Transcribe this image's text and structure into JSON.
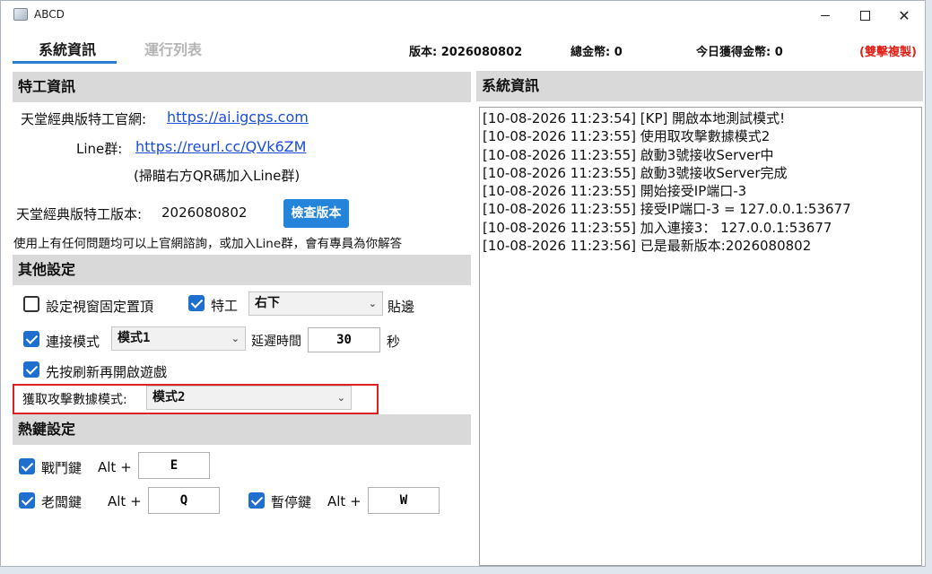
{
  "window": {
    "title": "ABCD"
  },
  "tabs": [
    {
      "label": "系統資訊"
    },
    {
      "label": "運行列表"
    }
  ],
  "header": {
    "version": "版本: 2026080802",
    "total_coins": "總金幣:  0",
    "today_coins": "今日獲得金幣:  0",
    "dual_mode": "(雙擊複製)"
  },
  "agent_info": {
    "heading": "特工資訊",
    "site_label": "天堂經典版特工官網:",
    "site_url": "https://ai.igcps.com",
    "line_label": "Line群:",
    "line_url": "https://reurl.cc/QVk6ZM",
    "qr_note": "(掃瞄右方QR碼加入Line群)",
    "version_label": "天堂經典版特工版本:",
    "version_value": "2026080802",
    "check_button": "檢查版本",
    "help_text": "使用上有任何問題均可以上官網諮詢，或加入Line群，會有專員為你解答"
  },
  "other_settings": {
    "heading": "其他設定",
    "fixed_top": {
      "label": "設定視窗固定置頂",
      "checked": false
    },
    "agent": {
      "label": "特工",
      "checked": true
    },
    "position_select": "右下",
    "edge_label": "貼邊",
    "connect_mode": {
      "label": "連接模式",
      "checked": true
    },
    "mode_select": "模式1",
    "delay_label": "延遲時間",
    "delay_value": "30",
    "seconds_label": "秒",
    "refresh_first": {
      "label": "先按刷新再開啟遊戲",
      "checked": true
    },
    "attack_mode_label": "獲取攻擊數據模式:",
    "attack_mode_select": "模式2"
  },
  "hotkeys": {
    "heading": "熱鍵設定",
    "fight": {
      "label": "戰鬥鍵",
      "checked": true,
      "modifier": "Alt +",
      "key": "E"
    },
    "boss": {
      "label": "老闆鍵",
      "checked": true,
      "modifier": "Alt +",
      "key": "Q"
    },
    "pause": {
      "label": "暫停鍵",
      "checked": true,
      "modifier": "Alt +",
      "key": "W"
    }
  },
  "system_info": {
    "heading": "系統資訊",
    "log": [
      "[10-08-2026 11:23:54] [KP] 開啟本地測試模式!",
      "[10-08-2026 11:23:55] 使用取攻擊數據模式2",
      "[10-08-2026 11:23:55] 啟動3號接收Server中",
      "[10-08-2026 11:23:55] 啟動3號接收Server完成",
      "[10-08-2026 11:23:55] 開始接受IP端口-3",
      "[10-08-2026 11:23:55] 接受IP端口-3 =  127.0.0.1:53677",
      "[10-08-2026 11:23:55] 加入連接3：  127.0.0.1:53677",
      "[10-08-2026 11:23:56] 已是最新版本:2026080802"
    ]
  },
  "colors": {
    "accent": "#2384d9",
    "highlight": "#e02020",
    "panel_head": "#d9d9d9",
    "red_text": "#e0241b"
  }
}
